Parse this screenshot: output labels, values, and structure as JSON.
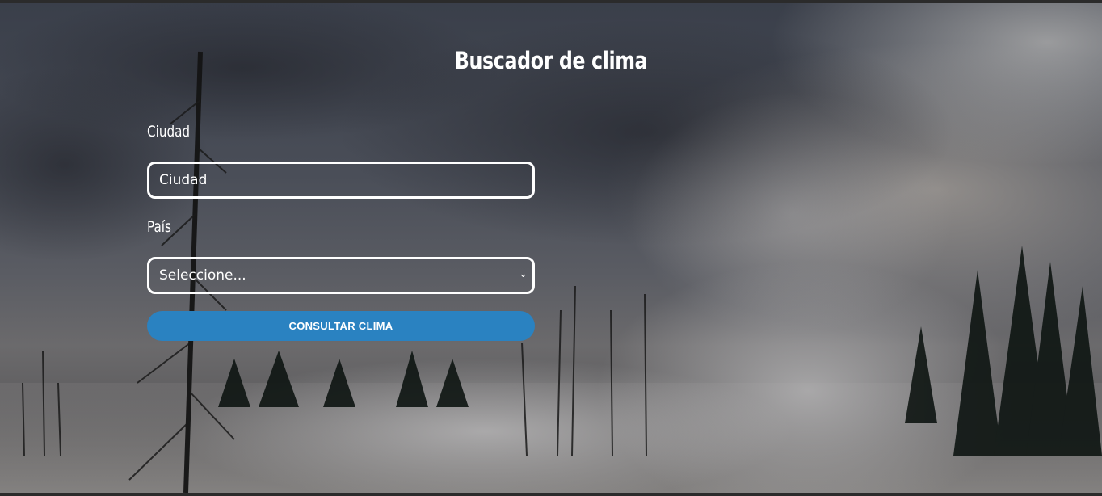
{
  "page": {
    "title": "Buscador de clima"
  },
  "form": {
    "city_label": "Ciudad",
    "city_value": "Ciudad",
    "country_label": "País",
    "country_selected": "Seleccione...",
    "submit_label": "CONSULTAR CLIMA"
  },
  "colors": {
    "button": "#2a82c1",
    "text": "#ffffff",
    "border": "#ffffff"
  },
  "icons": {
    "select_arrow": "chevron-down-icon"
  }
}
